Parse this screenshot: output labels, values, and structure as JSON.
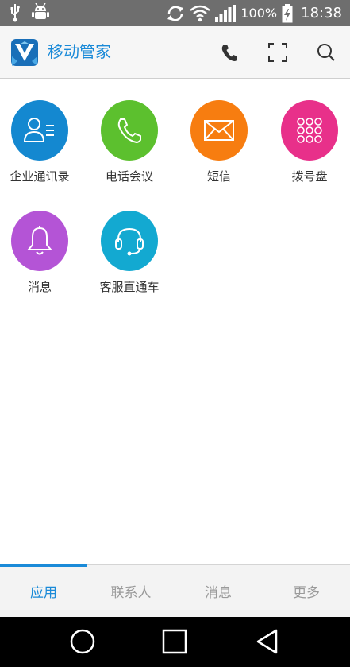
{
  "status_bar": {
    "battery_percent": "100%",
    "time": "18:38",
    "icons": [
      "usb-icon",
      "android-debug-icon",
      "sync-icon",
      "wifi-icon",
      "signal-icon",
      "battery-charging-icon"
    ]
  },
  "app_bar": {
    "title": "移动管家",
    "actions": [
      "phone-icon",
      "scan-icon",
      "search-icon"
    ]
  },
  "apps": [
    {
      "label": "企业通讯录",
      "icon": "contact-card-icon",
      "color": "#1488d0"
    },
    {
      "label": "电话会议",
      "icon": "phone-icon",
      "color": "#5cc02e"
    },
    {
      "label": "短信",
      "icon": "envelope-icon",
      "color": "#f77d10"
    },
    {
      "label": "拨号盘",
      "icon": "dialpad-icon",
      "color": "#e8308a"
    },
    {
      "label": "消息",
      "icon": "bell-icon",
      "color": "#b454d6"
    },
    {
      "label": "客服直通车",
      "icon": "headset-icon",
      "color": "#13a9d1"
    }
  ],
  "bottom_nav": {
    "tabs": [
      {
        "label": "应用",
        "active": true
      },
      {
        "label": "联系人",
        "active": false
      },
      {
        "label": "消息",
        "active": false
      },
      {
        "label": "更多",
        "active": false
      }
    ],
    "active_color": "#1a8ad8"
  },
  "system_nav": [
    "home-icon",
    "recent-apps-icon",
    "back-icon"
  ]
}
